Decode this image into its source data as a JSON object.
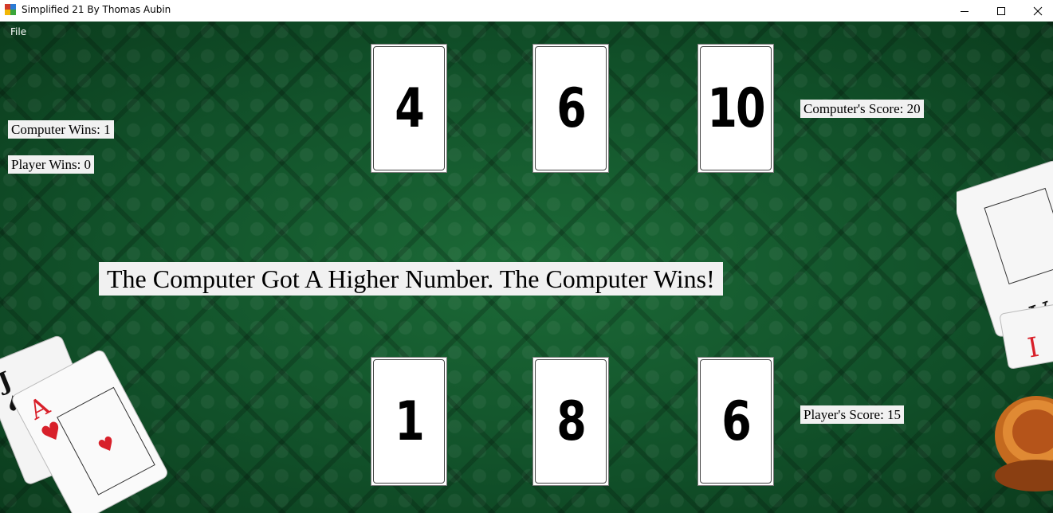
{
  "window": {
    "title": "Simplified 21 By Thomas Aubin",
    "icons": [
      "app-icon",
      "minimize-icon",
      "maximize-icon",
      "close-icon"
    ]
  },
  "menu": {
    "file_label": "File"
  },
  "scoreboard": {
    "computer_wins": "Computer Wins: 1",
    "player_wins": "Player Wins: 0"
  },
  "computer": {
    "cards": [
      "4",
      "6",
      "10"
    ],
    "score_label": "Computer's Score: 20"
  },
  "player": {
    "cards": [
      "1",
      "8",
      "6"
    ],
    "score_label": "Player's Score: 15"
  },
  "result_message": "The Computer Got A Higher Number. The Computer Wins!",
  "colors": {
    "felt": "#12532a",
    "label_bg": "#f1f1f1",
    "card_bg": "#ffffff",
    "suit_red": "#d8202a"
  }
}
